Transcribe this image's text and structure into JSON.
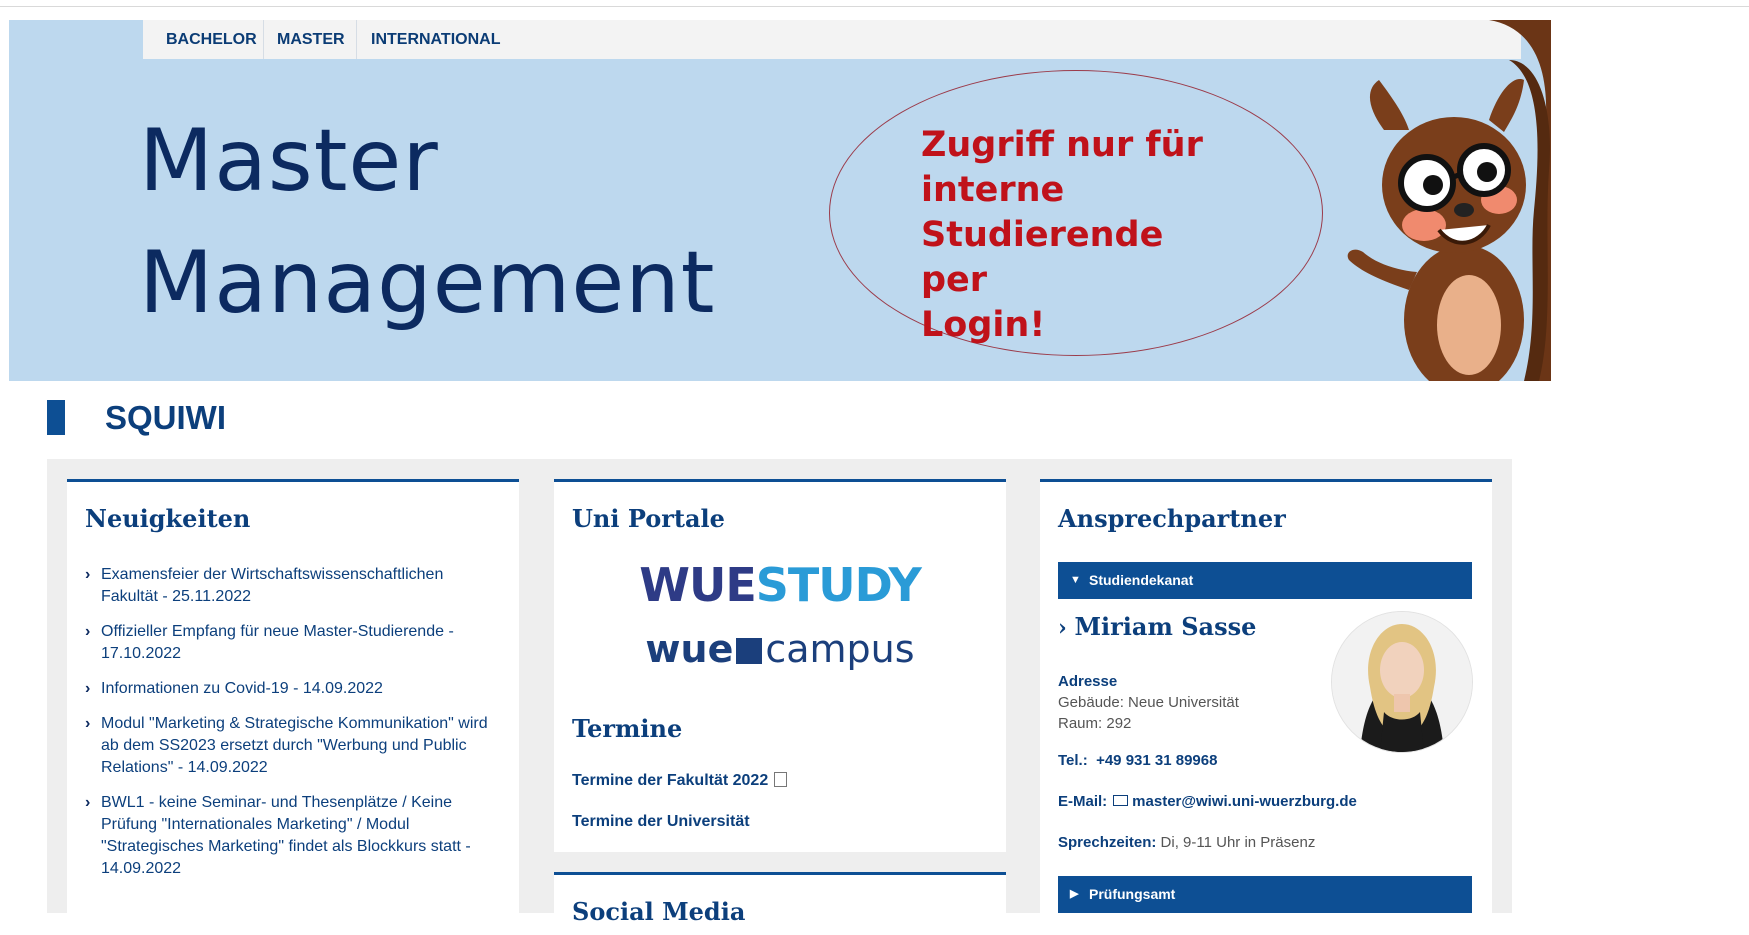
{
  "nav": {
    "items": [
      "BACHELOR",
      "MASTER",
      "INTERNATIONAL"
    ]
  },
  "banner": {
    "title_line1": "Master",
    "title_line2": "Management",
    "notice_line1": "Zugriff nur für",
    "notice_line2": "interne",
    "notice_line3": "Studierende per",
    "notice_line4": "Login!"
  },
  "page": {
    "heading": "SQUIWI"
  },
  "news": {
    "title": "Neuigkeiten",
    "items": [
      "Examensfeier der Wirtschaftswissenschaftlichen Fakultät - 25.11.2022",
      "Offizieller Empfang für neue Master-Studierende - 17.10.2022",
      "Informationen zu Covid-19 - 14.09.2022",
      "Modul \"Marketing & Strategische Kommunikation\" wird ab dem SS2023 ersetzt durch \"Werbung und Public Relations\" - 14.09.2022",
      "BWL1 - keine Seminar- und Thesenplätze / Keine Prüfung \"Internationales Marketing\" / Modul \"Strategisches Marketing\" findet als Blockkurs statt - 14.09.2022"
    ]
  },
  "portals": {
    "title": "Uni Portale",
    "logo1_part1": "WUE",
    "logo1_part2": "STUDY",
    "logo2_part1": "wue",
    "logo2_part2": "campus",
    "termine_title": "Termine",
    "termine_link1": "Termine der Fakultät 2022",
    "termine_link2": "Termine der Universität",
    "social_title": "Social Media"
  },
  "contact": {
    "title": "Ansprechpartner",
    "section1": "Studiendekanat",
    "name": "Miriam Sasse",
    "address_label": "Adresse",
    "address_line1": "Gebäude: Neue Universität",
    "address_line2": "Raum: 292",
    "tel_label": "Tel.:",
    "tel_value": "+49 931 31 89968",
    "email_label": "E-Mail:",
    "email_value": "master@wiwi.uni-wuerzburg.de",
    "hours_label": "Sprechzeiten:",
    "hours_value": "Di, 9-11 Uhr in Präsenz",
    "section2": "Prüfungsamt"
  },
  "colors": {
    "primary": "#0d4f94",
    "banner_bg": "#bdd8ee",
    "notice_red": "#c0121a"
  }
}
